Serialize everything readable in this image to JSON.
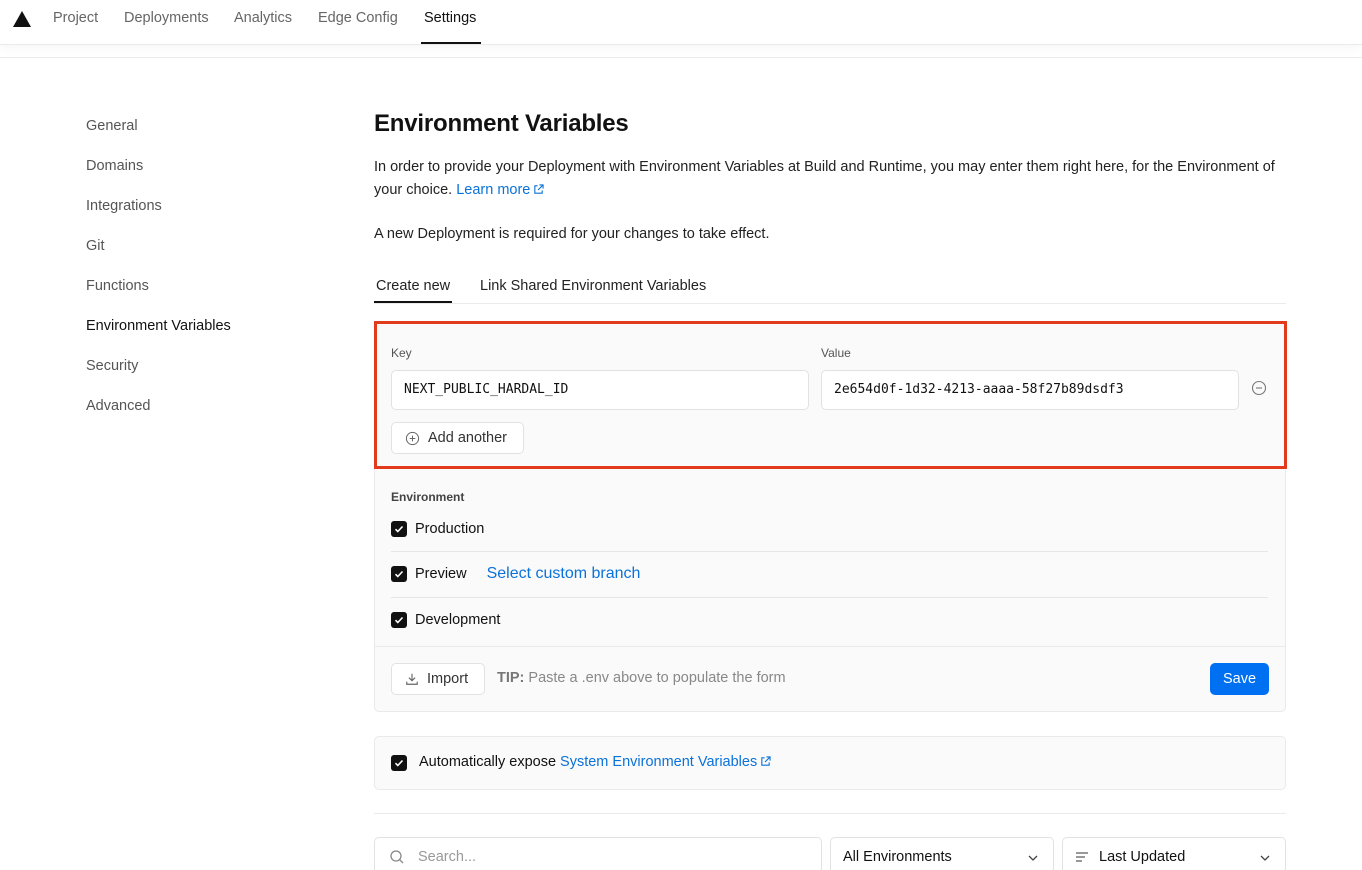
{
  "topnav": {
    "tabs": [
      "Project",
      "Deployments",
      "Analytics",
      "Edge Config",
      "Settings"
    ],
    "active": "Settings"
  },
  "sidebar": {
    "items": [
      {
        "label": "General"
      },
      {
        "label": "Domains"
      },
      {
        "label": "Integrations"
      },
      {
        "label": "Git"
      },
      {
        "label": "Functions"
      },
      {
        "label": "Environment Variables"
      },
      {
        "label": "Security"
      },
      {
        "label": "Advanced"
      }
    ],
    "active": "Environment Variables"
  },
  "main": {
    "title": "Environment Variables",
    "description": "In order to provide your Deployment with Environment Variables at Build and Runtime, you may enter them right here, for the Environment of your choice.",
    "learn_more": "Learn more",
    "note": "A new Deployment is required for your changes to take effect.",
    "tabs": [
      {
        "label": "Create new"
      },
      {
        "label": "Link Shared Environment Variables"
      }
    ]
  },
  "form": {
    "key_label": "Key",
    "value_label": "Value",
    "key_value": "NEXT_PUBLIC_HARDAL_ID",
    "value_value": "2e654d0f-1d32-4213-aaaa-58f27b89dsdf3",
    "add_another": "Add another",
    "environment_label": "Environment",
    "environments": [
      {
        "label": "Production",
        "checked": true
      },
      {
        "label": "Preview",
        "checked": true
      },
      {
        "label": "Development",
        "checked": true
      }
    ],
    "custom_branch": "Select custom branch",
    "import": "Import",
    "tip_label": "TIP:",
    "tip_text": "Paste a .env above to populate the form",
    "save": "Save"
  },
  "auto_expose": {
    "checked": true,
    "text": "Automatically expose",
    "link": "System Environment Variables"
  },
  "filters": {
    "search_placeholder": "Search...",
    "environment_select": "All Environments",
    "sort_select": "Last Updated"
  },
  "colors": {
    "accent": "#0070f3",
    "link": "#0a72d9",
    "highlight": "#e23b1c"
  }
}
